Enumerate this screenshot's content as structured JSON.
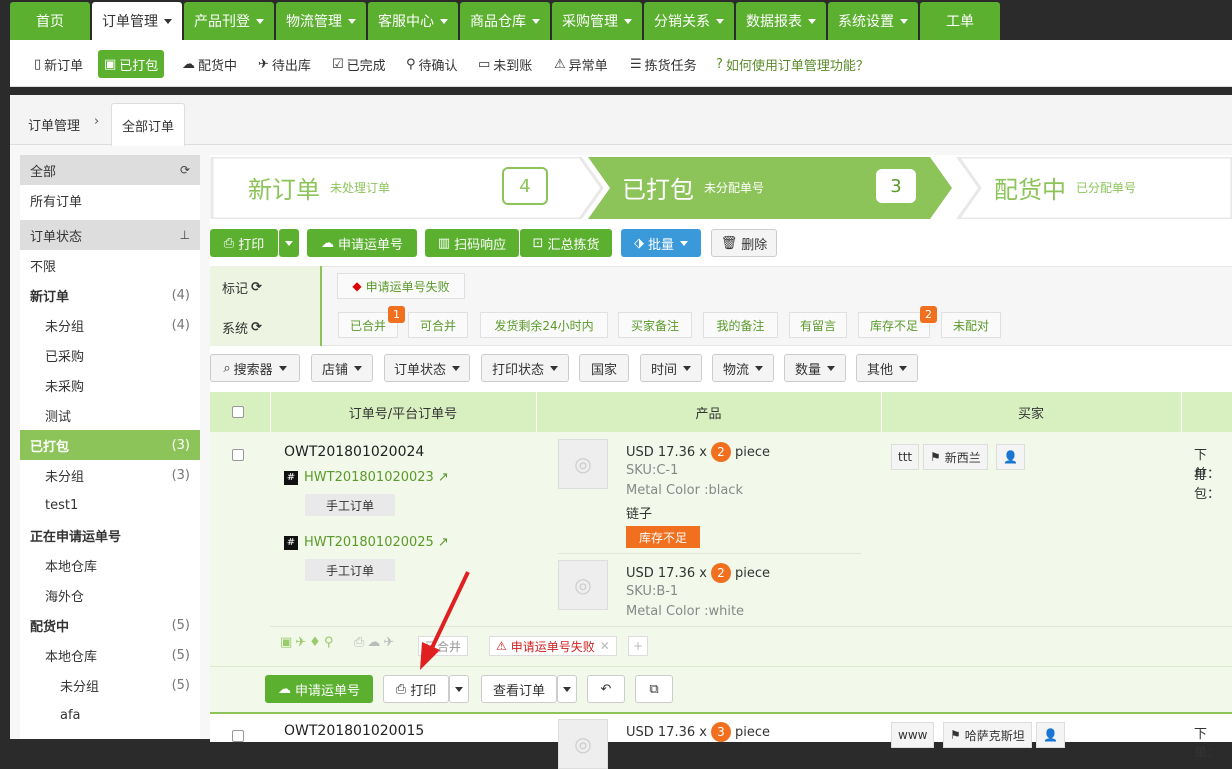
{
  "topnav": {
    "items": [
      "首页",
      "订单管理",
      "产品刊登",
      "物流管理",
      "客服中心",
      "商品仓库",
      "采购管理",
      "分销关系",
      "数据报表",
      "系统设置",
      "工单"
    ]
  },
  "subnav": {
    "items": [
      "新订单",
      "已打包",
      "配货中",
      "待出库",
      "已完成",
      "待确认",
      "未到账",
      "异常单",
      "拣货任务"
    ],
    "help": "如何使用订单管理功能？"
  },
  "breadcrumb": {
    "root": "订单管理",
    "current": "全部订单"
  },
  "sidebar": {
    "all": "全部",
    "all_orders": "所有订单",
    "status": "订单状态",
    "unlimited": "不限",
    "new_order": "新订单",
    "new_count": "(4)",
    "unassigned": "未分组",
    "unassigned_count": "(4)",
    "purchased": "已采购",
    "not_purchased": "未采购",
    "test": "测试",
    "packed": "已打包",
    "packed_count": "(3)",
    "packed_unassigned": "未分组",
    "packed_unassigned_count": "(3)",
    "test1": "test1",
    "applying": "正在申请运单号",
    "local_wh": "本地仓库",
    "overseas_wh": "海外仓",
    "picking": "配货中",
    "picking_count": "(5)",
    "picking_local": "本地仓库",
    "picking_local_count": "(5)",
    "picking_unassigned": "未分组",
    "picking_unassigned_count": "(5)",
    "afa": "afa"
  },
  "steps": [
    {
      "title": "新订单",
      "sub": "未处理订单",
      "count": "4"
    },
    {
      "title": "已打包",
      "sub": "未分配单号",
      "count": "3"
    },
    {
      "title": "配货中",
      "sub": "已分配单号"
    }
  ],
  "actions": {
    "print": "打印",
    "apply": "申请运单号",
    "scan": "扫码响应",
    "summary": "汇总拣货",
    "batch": "批量",
    "delete": "删除"
  },
  "mark": {
    "label": "标记",
    "tag": "申请运单号失败"
  },
  "system": {
    "label": "系统",
    "tags": [
      "已合并",
      "可合并",
      "发货剩余24小时内",
      "买家备注",
      "我的备注",
      "有留言",
      "库存不足",
      "未配对"
    ],
    "badge_merged": "1",
    "badge_stock": "2"
  },
  "filters": [
    "搜索器",
    "店铺",
    "订单状态",
    "打印状态",
    "国家",
    "时间",
    "物流",
    "数量",
    "其他"
  ],
  "table": {
    "headers": [
      "订单号/平台订单号",
      "产品",
      "买家"
    ]
  },
  "order1": {
    "id": "OWT201801020024",
    "subs": [
      {
        "id": "HWT201801020023",
        "type": "手工订单"
      },
      {
        "id": "HWT201801020025",
        "type": "手工订单"
      }
    ],
    "products": [
      {
        "price": "USD 17.36 x",
        "qty": "2",
        "unit": "piece",
        "sku": "SKU:C-1",
        "attr": "Metal Color :black",
        "name": "链子",
        "warn": "库存不足"
      },
      {
        "price": "USD 17.36 x",
        "qty": "2",
        "unit": "piece",
        "sku": "SKU:B-1",
        "attr": "Metal Color :white"
      }
    ],
    "buyer": "ttt",
    "country": "新西兰",
    "right": [
      "下单：",
      "打包："
    ],
    "tags": {
      "merged": "已合并",
      "fail": "申请运单号失败"
    },
    "buttons": {
      "apply": "申请运单号",
      "print": "打印",
      "view": "查看订单"
    }
  },
  "order2": {
    "id": "OWT201801020015",
    "price": "USD 17.36 x",
    "qty": "3",
    "unit": "piece",
    "buyer": "www",
    "country": "哈萨克斯坦",
    "right": "下单："
  },
  "colors": {
    "green": "#5cb030",
    "light_green": "#8dc45a",
    "orange": "#f07020",
    "blue": "#3a9ad9",
    "red": "#cc2222"
  }
}
